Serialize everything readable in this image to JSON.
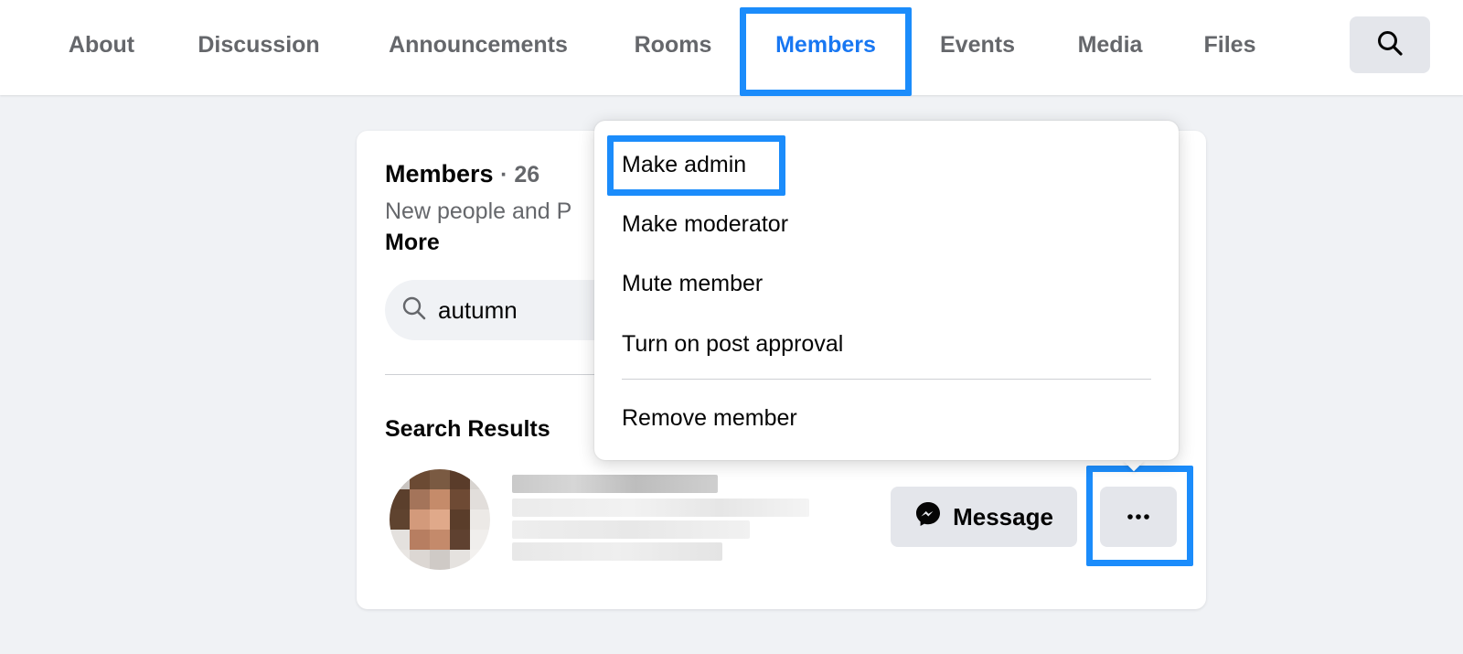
{
  "tabs": [
    {
      "label": "About"
    },
    {
      "label": "Discussion"
    },
    {
      "label": "Announcements"
    },
    {
      "label": "Rooms"
    },
    {
      "label": "Members"
    },
    {
      "label": "Events"
    },
    {
      "label": "Media"
    },
    {
      "label": "Files"
    }
  ],
  "active_tab": "Members",
  "members_card": {
    "title": "Members",
    "count": "· 26",
    "description": "New people and P",
    "more_label": "More",
    "search_value": "autumn",
    "results_label": "Search Results",
    "message_label": "Message"
  },
  "menu": {
    "items": [
      {
        "label": "Make admin"
      },
      {
        "label": "Make moderator"
      },
      {
        "label": "Mute member"
      },
      {
        "label": "Turn on post approval"
      },
      {
        "label": "Remove member"
      }
    ]
  },
  "colors": {
    "accent": "#1877f2",
    "highlight_box": "#1b8cfb",
    "tab_text": "#65676b",
    "background": "#f0f2f5"
  },
  "icons": {
    "search": "search-icon",
    "messenger": "messenger-icon",
    "more": "more-horizontal-icon"
  }
}
